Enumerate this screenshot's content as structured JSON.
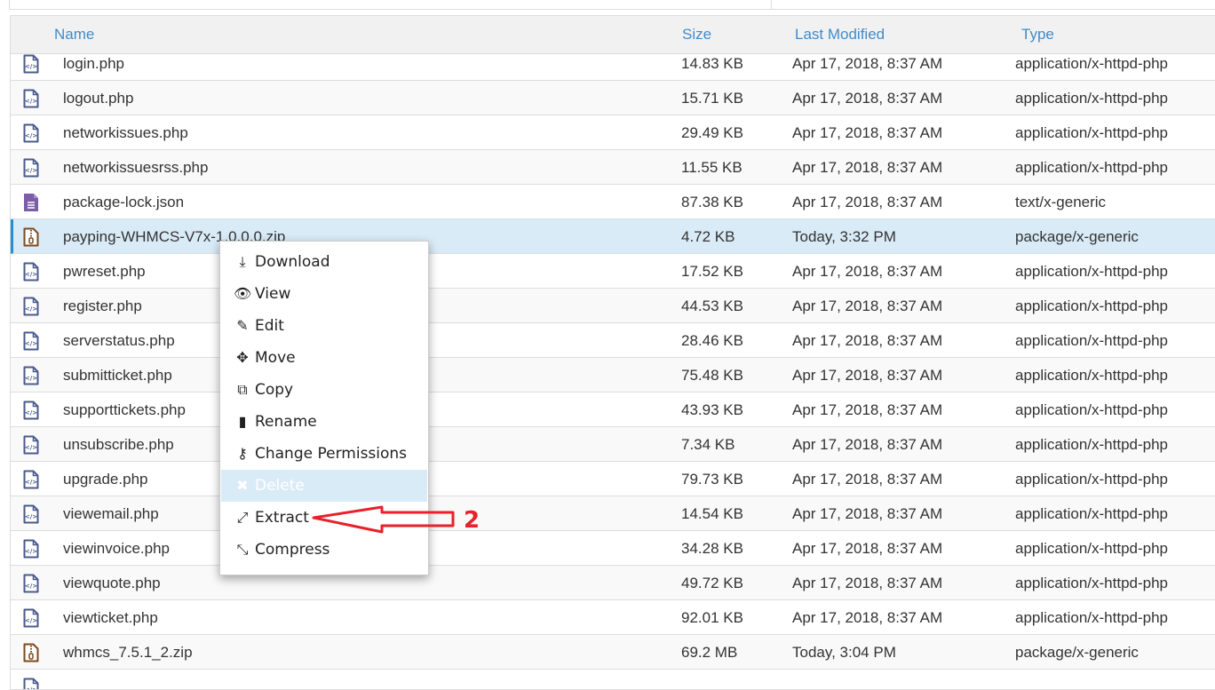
{
  "columns": {
    "name": "Name",
    "size": "Size",
    "modified": "Last Modified",
    "type": "Type"
  },
  "files": [
    {
      "name": "login.php",
      "size": "14.83 KB",
      "modified": "Apr 17, 2018, 8:37 AM",
      "type": "application/x-httpd-php",
      "icon": "php"
    },
    {
      "name": "logout.php",
      "size": "15.71 KB",
      "modified": "Apr 17, 2018, 8:37 AM",
      "type": "application/x-httpd-php",
      "icon": "php"
    },
    {
      "name": "networkissues.php",
      "size": "29.49 KB",
      "modified": "Apr 17, 2018, 8:37 AM",
      "type": "application/x-httpd-php",
      "icon": "php"
    },
    {
      "name": "networkissuesrss.php",
      "size": "11.55 KB",
      "modified": "Apr 17, 2018, 8:37 AM",
      "type": "application/x-httpd-php",
      "icon": "php"
    },
    {
      "name": "package-lock.json",
      "size": "87.38 KB",
      "modified": "Apr 17, 2018, 8:37 AM",
      "type": "text/x-generic",
      "icon": "text"
    },
    {
      "name": "payping-WHMCS-V7x-1.0.0.0.zip",
      "size": "4.72 KB",
      "modified": "Today, 3:32 PM",
      "type": "package/x-generic",
      "icon": "zip",
      "selected": true
    },
    {
      "name": "pwreset.php",
      "size": "17.52 KB",
      "modified": "Apr 17, 2018, 8:37 AM",
      "type": "application/x-httpd-php",
      "icon": "php"
    },
    {
      "name": "register.php",
      "size": "44.53 KB",
      "modified": "Apr 17, 2018, 8:37 AM",
      "type": "application/x-httpd-php",
      "icon": "php"
    },
    {
      "name": "serverstatus.php",
      "size": "28.46 KB",
      "modified": "Apr 17, 2018, 8:37 AM",
      "type": "application/x-httpd-php",
      "icon": "php"
    },
    {
      "name": "submitticket.php",
      "size": "75.48 KB",
      "modified": "Apr 17, 2018, 8:37 AM",
      "type": "application/x-httpd-php",
      "icon": "php"
    },
    {
      "name": "supporttickets.php",
      "size": "43.93 KB",
      "modified": "Apr 17, 2018, 8:37 AM",
      "type": "application/x-httpd-php",
      "icon": "php"
    },
    {
      "name": "unsubscribe.php",
      "size": "7.34 KB",
      "modified": "Apr 17, 2018, 8:37 AM",
      "type": "application/x-httpd-php",
      "icon": "php"
    },
    {
      "name": "upgrade.php",
      "size": "79.73 KB",
      "modified": "Apr 17, 2018, 8:37 AM",
      "type": "application/x-httpd-php",
      "icon": "php"
    },
    {
      "name": "viewemail.php",
      "size": "14.54 KB",
      "modified": "Apr 17, 2018, 8:37 AM",
      "type": "application/x-httpd-php",
      "icon": "php"
    },
    {
      "name": "viewinvoice.php",
      "size": "34.28 KB",
      "modified": "Apr 17, 2018, 8:37 AM",
      "type": "application/x-httpd-php",
      "icon": "php"
    },
    {
      "name": "viewquote.php",
      "size": "49.72 KB",
      "modified": "Apr 17, 2018, 8:37 AM",
      "type": "application/x-httpd-php",
      "icon": "php"
    },
    {
      "name": "viewticket.php",
      "size": "92.01 KB",
      "modified": "Apr 17, 2018, 8:37 AM",
      "type": "application/x-httpd-php",
      "icon": "php"
    },
    {
      "name": "whmcs_7.5.1_2.zip",
      "size": "69.2 MB",
      "modified": "Today, 3:04 PM",
      "type": "package/x-generic",
      "icon": "zip"
    },
    {
      "name": "",
      "size": "",
      "modified": "",
      "type": "",
      "icon": "php"
    }
  ],
  "context_menu": [
    {
      "label": "Download",
      "icon": "download-icon",
      "glyph": "⤓"
    },
    {
      "label": "View",
      "icon": "eye-icon",
      "glyph": "👁"
    },
    {
      "label": "Edit",
      "icon": "pencil-icon",
      "glyph": "✎"
    },
    {
      "label": "Move",
      "icon": "move-icon",
      "glyph": "✥"
    },
    {
      "label": "Copy",
      "icon": "copy-icon",
      "glyph": "⧉"
    },
    {
      "label": "Rename",
      "icon": "file-icon",
      "glyph": "▮"
    },
    {
      "label": "Change Permissions",
      "icon": "key-icon",
      "glyph": "⚷"
    },
    {
      "label": "Delete",
      "icon": "close-icon",
      "glyph": "✖",
      "highlighted": true
    },
    {
      "label": "Extract",
      "icon": "expand-icon",
      "glyph": "⤢"
    },
    {
      "label": "Compress",
      "icon": "compress-icon",
      "glyph": "⤡"
    }
  ],
  "annotation": {
    "step": "2",
    "color": "#e8212b"
  },
  "colors": {
    "header_link": "#428bca",
    "selected_row": "#d9ebf7",
    "php_icon": "#4a5a8c",
    "zip_icon": "#7a4a1f",
    "text_icon": "#7b5ea7"
  }
}
